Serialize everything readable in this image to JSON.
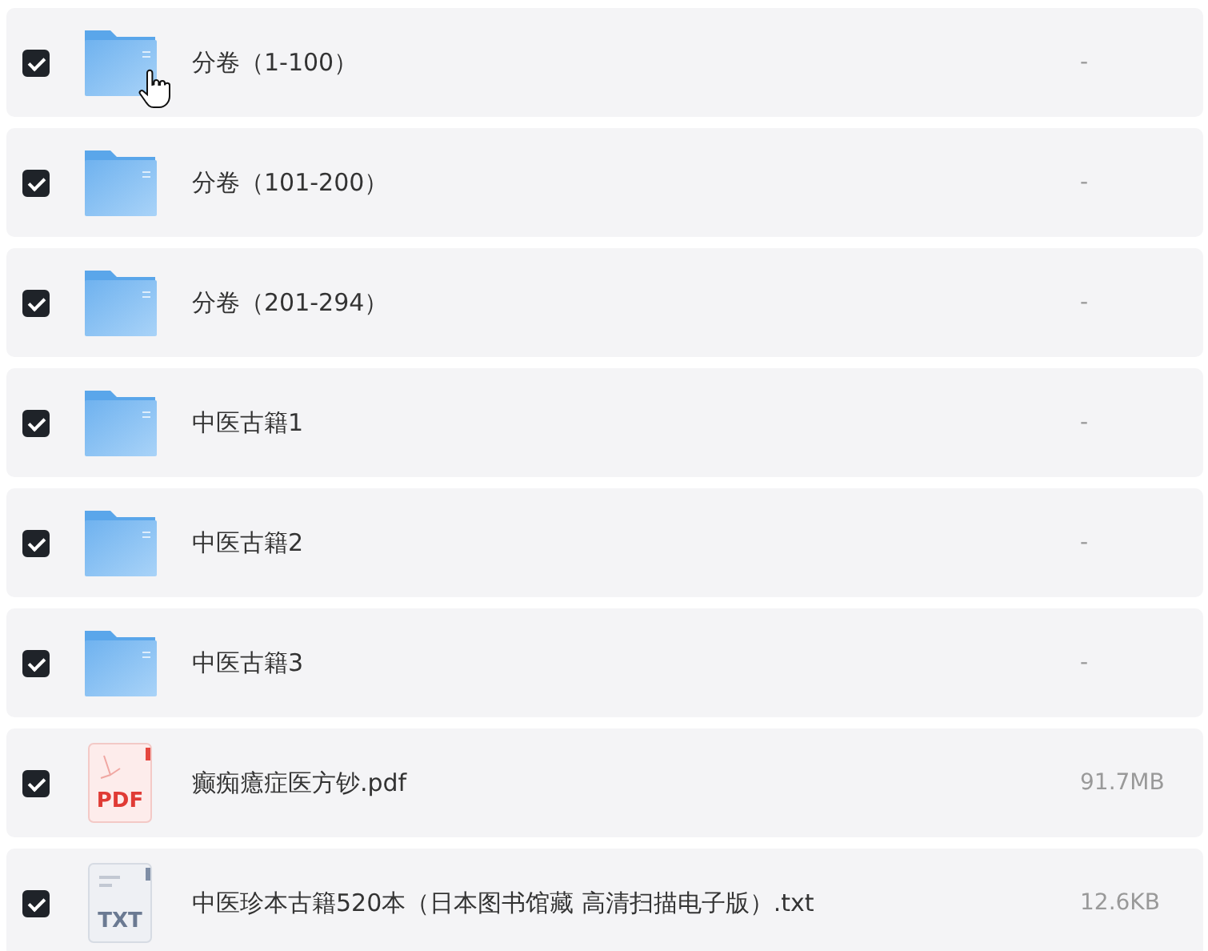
{
  "files": [
    {
      "kind": "folder",
      "name": "分卷（1-100）",
      "size": "-",
      "checked": true,
      "hovered": true
    },
    {
      "kind": "folder",
      "name": "分卷（101-200）",
      "size": "-",
      "checked": true,
      "hovered": false
    },
    {
      "kind": "folder",
      "name": "分卷（201-294）",
      "size": "-",
      "checked": true,
      "hovered": false
    },
    {
      "kind": "folder",
      "name": "中医古籍1",
      "size": "-",
      "checked": true,
      "hovered": false
    },
    {
      "kind": "folder",
      "name": "中医古籍2",
      "size": "-",
      "checked": true,
      "hovered": false
    },
    {
      "kind": "folder",
      "name": "中医古籍3",
      "size": "-",
      "checked": true,
      "hovered": false
    },
    {
      "kind": "pdf",
      "badge": "PDF",
      "name": "癫痴癔症医方钞.pdf",
      "size": "91.7MB",
      "checked": true,
      "hovered": false
    },
    {
      "kind": "txt",
      "badge": "TXT",
      "name": "中医珍本古籍520本（日本图书馆藏 高清扫描电子版）.txt",
      "size": "12.6KB",
      "checked": true,
      "hovered": false
    }
  ]
}
